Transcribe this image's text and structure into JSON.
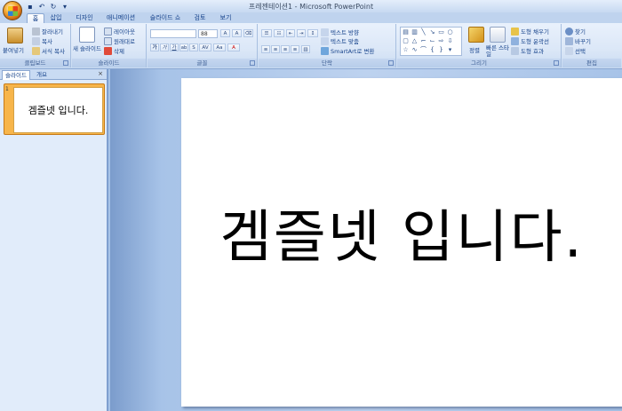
{
  "window": {
    "title": "프레젠테이션1 - Microsoft PowerPoint"
  },
  "quick_access": [
    {
      "name": "save-icon",
      "glyph": "▪"
    },
    {
      "name": "undo-icon",
      "glyph": "↶"
    },
    {
      "name": "redo-icon",
      "glyph": "↻"
    },
    {
      "name": "customize-qat-icon",
      "glyph": "▾"
    }
  ],
  "tabs": [
    "홈",
    "삽입",
    "디자인",
    "애니메이션",
    "슬라이드 쇼",
    "검토",
    "보기"
  ],
  "active_tab": "홈",
  "ribbon": {
    "clipboard": {
      "label": "클립보드",
      "paste": "붙여넣기",
      "cut": "잘라내기",
      "copy": "복사",
      "format_painter": "서식 복사"
    },
    "slides": {
      "label": "슬라이드",
      "new_slide": "새 슬라이드",
      "layout": "레이아웃",
      "reset": "원래대로",
      "delete": "삭제"
    },
    "font": {
      "label": "글꼴",
      "font_name": "",
      "font_size": "88"
    },
    "paragraph": {
      "label": "단락",
      "text_direction": "텍스트 방향",
      "align_text": "텍스트 맞춤",
      "smartart": "SmartArt로 변환"
    },
    "drawing": {
      "label": "그리기",
      "arrange": "정렬",
      "quick_styles": "빠른 스타일",
      "shape_fill": "도형 채우기",
      "shape_outline": "도형 윤곽선",
      "shape_effects": "도형 효과"
    },
    "editing": {
      "label": "편집",
      "find": "찾기",
      "replace": "바꾸기",
      "select": "선택"
    }
  },
  "panel": {
    "tab_slides": "슬라이드",
    "tab_outline": "개요",
    "close": "×",
    "thumbnail_number": "1",
    "thumbnail_text": "겜즐넷 입니다."
  },
  "slide": {
    "text": "겜즐넷 입니다."
  },
  "colors": {
    "ribbon_bg": "#dbe7f7",
    "workspace_bg": "#a7c3e8",
    "thumb_highlight": "#f7b54a",
    "text_blue": "#15428b"
  }
}
